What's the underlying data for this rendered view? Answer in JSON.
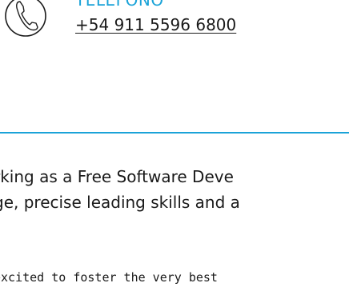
{
  "contact": {
    "icon": "phone-handset-icon",
    "label": "TELEFONO",
    "phone": "+54 911 5596 6800",
    "accent_color": "#1ba3d8"
  },
  "divider": {
    "color": "#1ba3d8"
  },
  "intro": {
    "lines": [
      "rking as a Free Software Deve",
      "ge, precise leading skills and a"
    ]
  },
  "code": {
    "line": "excited to foster the very best"
  }
}
